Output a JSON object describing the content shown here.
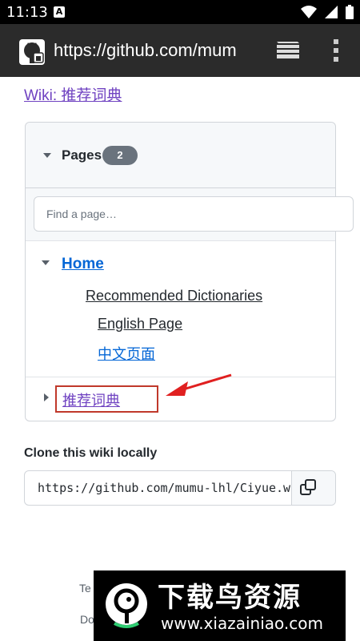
{
  "status_bar": {
    "time": "11:13",
    "notification_badge": "A",
    "icons": [
      "wifi-icon",
      "signal-icon",
      "battery-icon"
    ]
  },
  "browser": {
    "url": "https://github.com/mum",
    "icons": [
      "github-icon",
      "tabs-icon",
      "overflow-menu-icon"
    ]
  },
  "wiki": {
    "title": "Wiki: 推荐词典"
  },
  "pages_panel": {
    "label": "Pages",
    "count": "2",
    "search_placeholder": "Find a page…",
    "home_label": "Home",
    "home_children": [
      "Recommended Dictionaries",
      "English Page",
      "中文页面"
    ],
    "second_page_label": "推荐词典"
  },
  "clone": {
    "title": "Clone this wiki locally",
    "url": "https://github.com/mumu-lhl/Ciyue.wiki.git"
  },
  "footer": {
    "line1": "Te",
    "line2": "Do"
  },
  "watermark": {
    "title": "下载鸟资源",
    "url": "www.xiazainiao.com"
  },
  "colors": {
    "accent_link": "#0366d6",
    "visited_link": "#6f42c1",
    "highlight_box": "#c0392b",
    "badge": "#6a737d"
  }
}
